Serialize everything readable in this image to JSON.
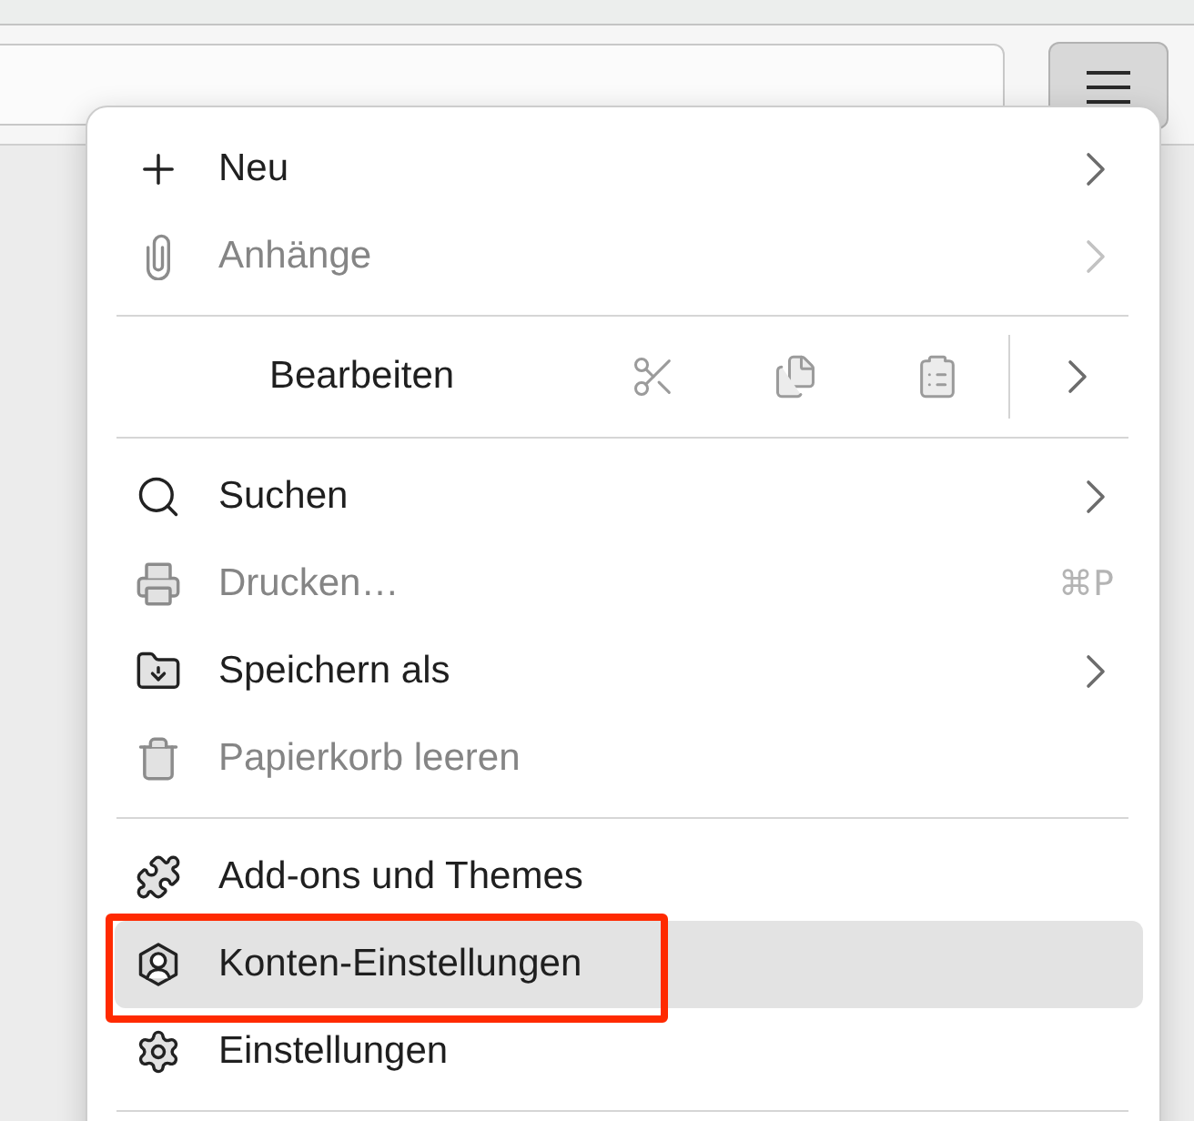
{
  "toolbar": {
    "menu_button": {
      "pressed": true
    }
  },
  "menu": {
    "entries": [
      {
        "kind": "item",
        "label": "Neu",
        "disabled": false,
        "submenu": true,
        "selected": false,
        "annotated": false
      },
      {
        "kind": "item",
        "label": "Anhänge",
        "disabled": true,
        "submenu": true,
        "selected": false,
        "annotated": false
      },
      {
        "kind": "separator"
      },
      {
        "kind": "edit",
        "label": "Bearbeiten",
        "buttons": [
          {
            "disabled": true
          },
          {
            "disabled": true
          },
          {
            "disabled": true
          }
        ],
        "submenu": true
      },
      {
        "kind": "separator"
      },
      {
        "kind": "item",
        "label": "Suchen",
        "disabled": false,
        "submenu": true,
        "selected": false,
        "annotated": false
      },
      {
        "kind": "item",
        "label": "Drucken…",
        "disabled": true,
        "submenu": false,
        "shortcut": "⌘P",
        "selected": false,
        "annotated": false
      },
      {
        "kind": "item",
        "label": "Speichern als",
        "disabled": false,
        "submenu": true,
        "selected": false,
        "annotated": false
      },
      {
        "kind": "item",
        "label": "Papierkorb leeren",
        "disabled": true,
        "submenu": false,
        "selected": false,
        "annotated": false
      },
      {
        "kind": "separator"
      },
      {
        "kind": "item",
        "label": "Add-ons und Themes",
        "disabled": false,
        "submenu": false,
        "selected": false,
        "annotated": false
      },
      {
        "kind": "item",
        "label": "Konten-Einstellungen",
        "disabled": false,
        "submenu": false,
        "selected": true,
        "annotated": true
      },
      {
        "kind": "item",
        "label": "Einstellungen",
        "disabled": false,
        "submenu": false,
        "selected": false,
        "annotated": false
      },
      {
        "kind": "separator"
      }
    ]
  }
}
